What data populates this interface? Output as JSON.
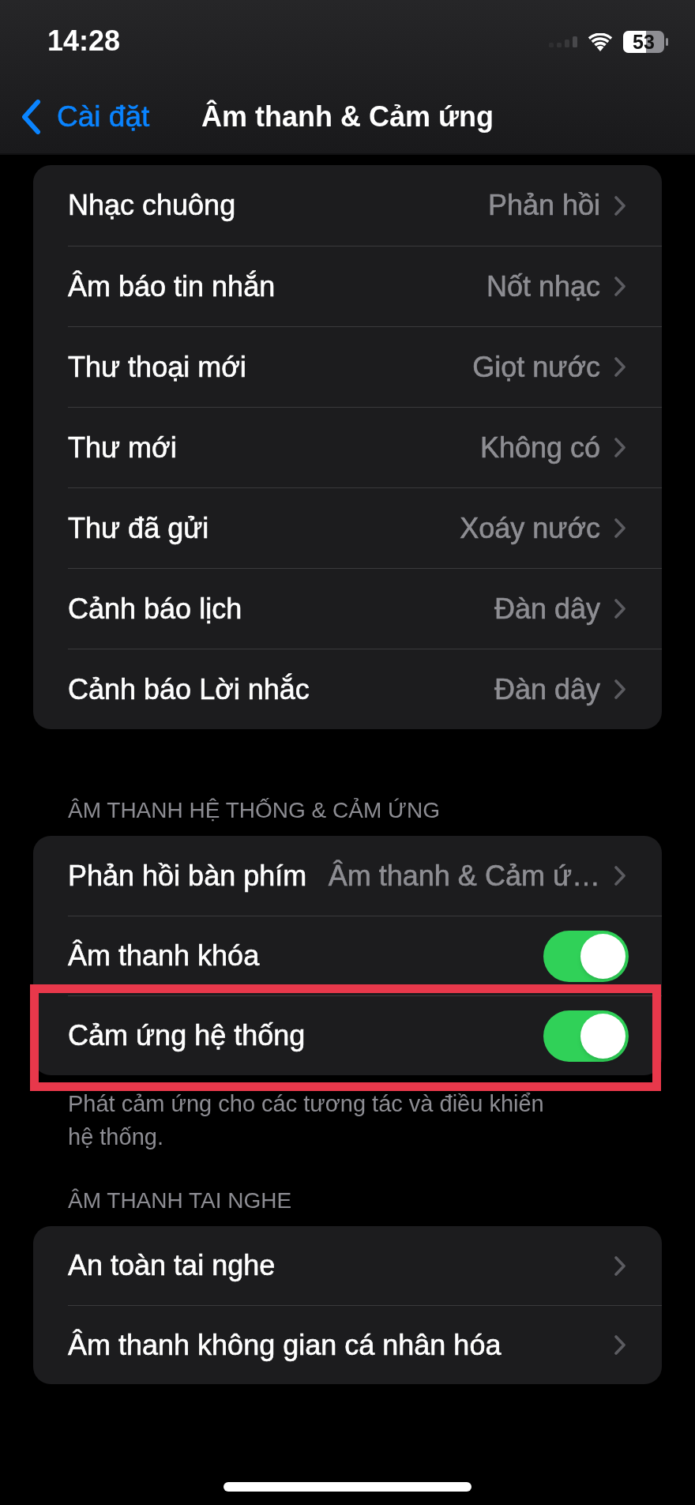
{
  "status_bar": {
    "time": "14:28",
    "battery": "53"
  },
  "navigation": {
    "back": "Cài đặt",
    "title": "Âm thanh & Cảm ứng"
  },
  "sections": [
    {
      "rows": [
        {
          "kind": "link",
          "label": "Nhạc chuông",
          "value": "Phản hồi",
          "highlighted": false
        },
        {
          "kind": "link",
          "label": "Âm báo tin nhắn",
          "value": "Nốt nhạc",
          "highlighted": false
        },
        {
          "kind": "link",
          "label": "Thư thoại mới",
          "value": "Giọt nước",
          "highlighted": false
        },
        {
          "kind": "link",
          "label": "Thư mới",
          "value": "Không có",
          "highlighted": false
        },
        {
          "kind": "link",
          "label": "Thư đã gửi",
          "value": "Xoáy nước",
          "highlighted": false
        },
        {
          "kind": "link",
          "label": "Cảnh báo lịch",
          "value": "Đàn dây",
          "highlighted": false
        },
        {
          "kind": "link",
          "label": "Cảnh báo Lời nhắc",
          "value": "Đàn dây",
          "highlighted": false
        }
      ]
    },
    {
      "header": "ÂM THANH HỆ THỐNG & CẢM ỨNG",
      "rows": [
        {
          "kind": "link",
          "label": "Phản hồi bàn phím",
          "value": "Âm thanh & Cảm ứ…",
          "highlighted": false
        },
        {
          "kind": "toggle",
          "label": "Âm thanh khóa",
          "on": true,
          "highlighted": false
        },
        {
          "kind": "toggle",
          "label": "Cảm ứng hệ thống",
          "on": true,
          "highlighted": true
        }
      ],
      "footer": "Phát cảm ứng cho các tương tác và điều khiển hệ thống."
    },
    {
      "header": "ÂM THANH TAI NGHE",
      "rows": [
        {
          "kind": "link",
          "label": "An toàn tai nghe",
          "highlighted": false
        },
        {
          "kind": "link",
          "label": "Âm thanh không gian cá nhân hóa",
          "highlighted": false
        }
      ]
    }
  ]
}
